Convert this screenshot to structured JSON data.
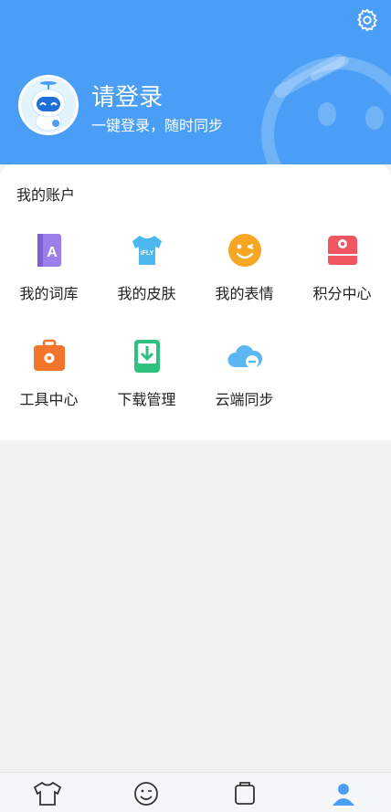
{
  "header": {
    "title": "请登录",
    "subtitle": "一键登录，随时同步"
  },
  "account": {
    "section_title": "我的账户",
    "items": [
      {
        "label": "我的词库",
        "icon": "dictionary-book-icon",
        "color": "#9b7ee8"
      },
      {
        "label": "我的皮肤",
        "icon": "tshirt-skin-icon",
        "color": "#4db8f0"
      },
      {
        "label": "我的表情",
        "icon": "wink-emoji-icon",
        "color": "#f5a623"
      },
      {
        "label": "积分中心",
        "icon": "points-gift-box-icon",
        "color": "#f05560"
      },
      {
        "label": "工具中心",
        "icon": "toolbox-gear-icon",
        "color": "#f2752b"
      },
      {
        "label": "下载管理",
        "icon": "download-manager-icon",
        "color": "#2ec27e"
      },
      {
        "label": "云端同步",
        "icon": "cloud-sync-icon",
        "color": "#5cb8f5"
      }
    ]
  },
  "tabbar": {
    "tabs": [
      {
        "icon": "tshirt-skin-tab-icon"
      },
      {
        "icon": "smiley-emoji-tab-icon"
      },
      {
        "icon": "tools-tab-icon"
      },
      {
        "icon": "profile-tab-icon",
        "active": true
      }
    ]
  },
  "colors": {
    "header_blue": "#4a9ef5",
    "page_bg": "#f2f2f2"
  }
}
